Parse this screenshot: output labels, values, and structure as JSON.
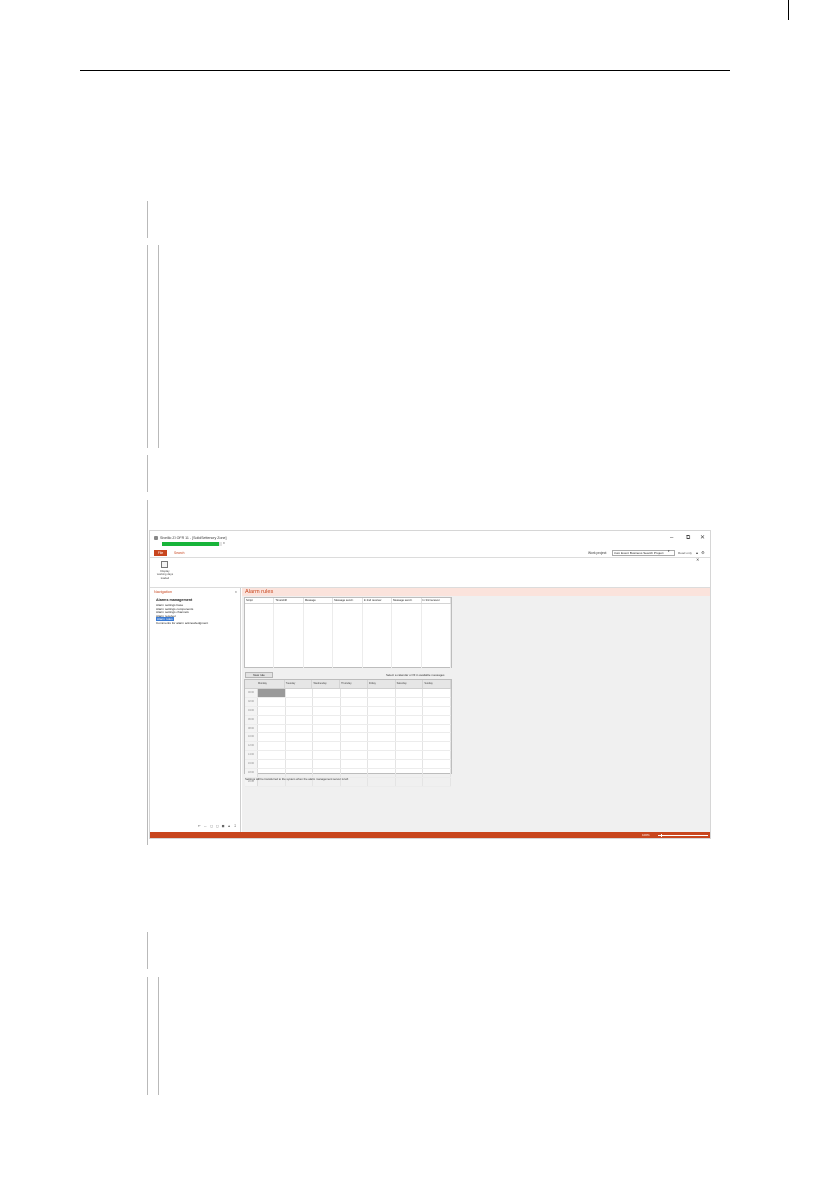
{
  "window": {
    "title": "Siveillo ZI OFR 11 - [SolidSettencry Zone]",
    "progress": 0.95,
    "close_progress": "x",
    "minimize": "–",
    "maximize": "⧉",
    "close": "✕"
  },
  "tabs": {
    "file": "Flie",
    "search": "Search"
  },
  "project": {
    "label": "Work project",
    "selected": "trum Event Business Search Project",
    "read_only": "Read only",
    "arrow": "▾",
    "extra_icons": "▴ ⚙ ✕"
  },
  "ribbon": {
    "button_label": "Display working days loaded"
  },
  "navigation": {
    "title": "Navigation",
    "close": "x",
    "heading": "Alarms management",
    "items": [
      "Alarm settings base",
      "Alarm settings components",
      "Alarm settings channels",
      "Alarm receiver",
      "Alarm rules",
      "Comments for alarm acknowledgment"
    ],
    "footer_icons": "⇤ ↔ ◻ ◻ ◼ ▲ ↧"
  },
  "main": {
    "title": "Alarm rules",
    "rule_columns": [
      "Script",
      "Time/shift",
      "Message",
      "Message send t",
      "In 2nd receiver",
      "Message send t",
      "In 3rd receiver"
    ],
    "new_rule_button": "New rule",
    "hint": "Select a calendar or fill in available messages",
    "weekday_columns": [
      "Monday",
      "Tuesday",
      "Wednesday",
      "Thursday",
      "Friday",
      "Saturday",
      "Sunday"
    ],
    "row_labels": [
      "00:00",
      "02:00",
      "04:00",
      "06:00",
      "08:00",
      "10:00",
      "12:00",
      "14:00",
      "16:00",
      "18:00",
      "20:00"
    ],
    "note": "Settings will be transferred to the system when the alarm management server is left"
  },
  "status": {
    "zoom": "100%"
  }
}
